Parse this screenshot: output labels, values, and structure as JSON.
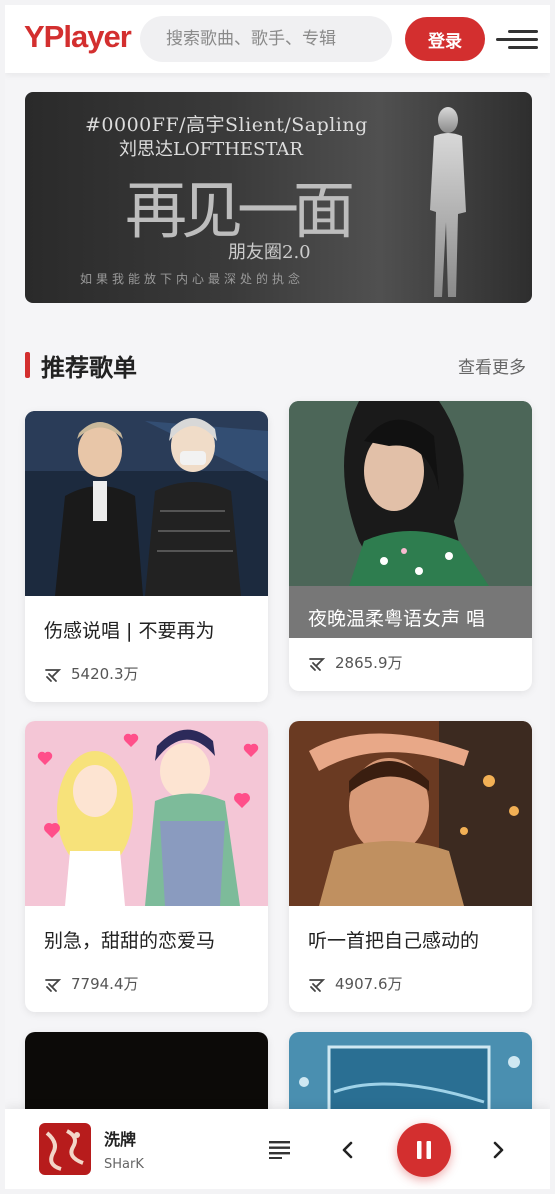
{
  "header": {
    "logo": "YPlayer",
    "search_placeholder": "搜索歌曲、歌手、专辑",
    "login_label": "登录"
  },
  "banner": {
    "line1": "#0000FF/高宇Slient/Sapling",
    "line2": "刘思达LOFTHESTAR",
    "title": "再见一面",
    "subtitle": "朋友圈2.0",
    "caption": "如果我能放下内心最深处的执念"
  },
  "section": {
    "title": "推荐歌单",
    "more_label": "查看更多"
  },
  "playlists": [
    {
      "title": "伤感说唱 | 不要再为",
      "plays": "5420.3万"
    },
    {
      "title": "夜晚温柔粤语女声 唱",
      "plays": "2865.9万"
    },
    {
      "title": "别急，甜甜的恋爱马",
      "plays": "7794.4万"
    },
    {
      "title": "听一首把自己感动的",
      "plays": "4907.6万"
    }
  ],
  "player": {
    "song": "洗牌",
    "artist": "SHarK"
  },
  "colors": {
    "accent": "#d32f2f"
  }
}
